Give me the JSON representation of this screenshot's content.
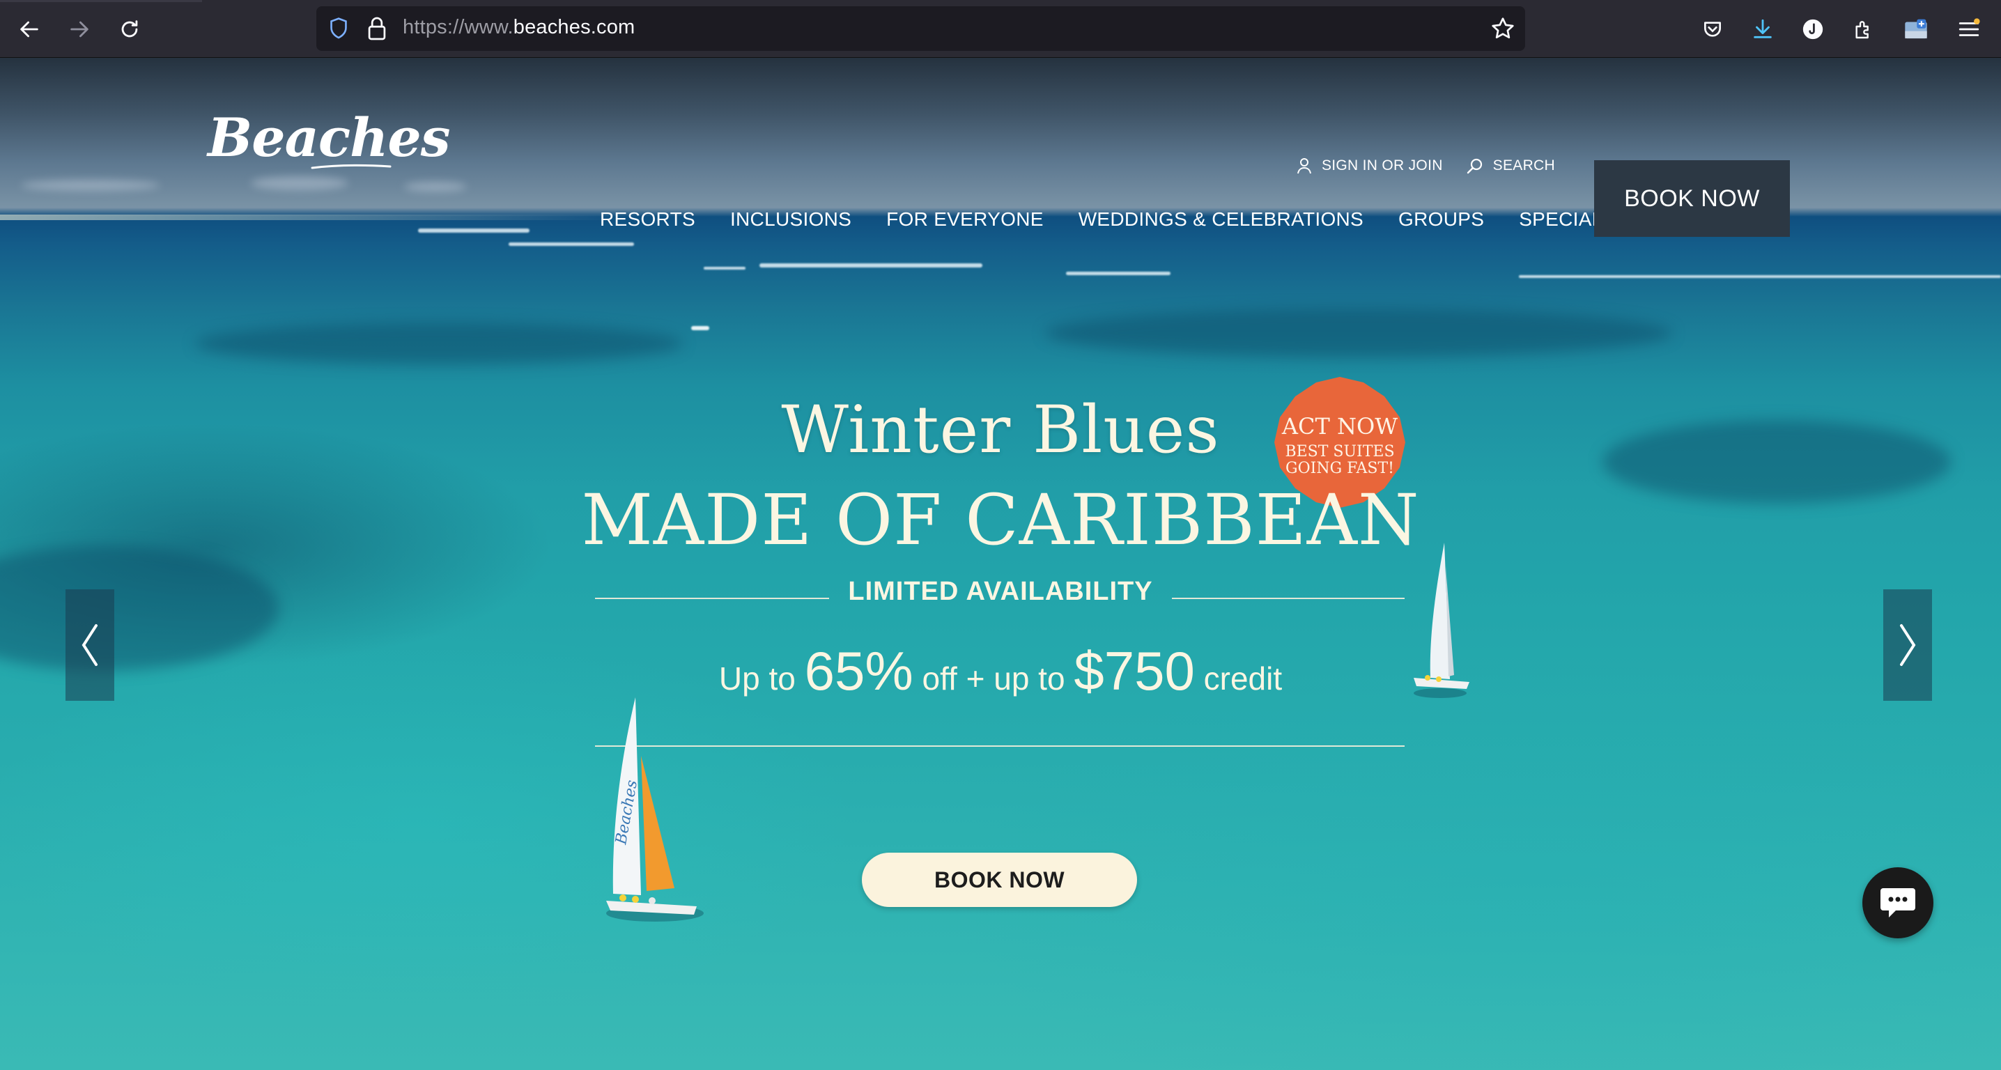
{
  "browser": {
    "url_dim": "https://www.",
    "url_domain": "beaches.com"
  },
  "header": {
    "logo": "Beaches",
    "sign_in": "SIGN IN OR JOIN",
    "search": "SEARCH",
    "book_now": "BOOK NOW",
    "nav": [
      "RESORTS",
      "INCLUSIONS",
      "FOR EVERYONE",
      "WEDDINGS & CELEBRATIONS",
      "GROUPS",
      "SPECIALS"
    ]
  },
  "hero": {
    "title_line1": "Winter Blues",
    "title_line2": "MADE OF CARIBBEAN",
    "limited": "LIMITED AVAILABILITY",
    "offer_prefix": "Up to",
    "offer_pct": "65%",
    "offer_mid": "off + up to",
    "offer_amount": "$750",
    "offer_suffix": "credit",
    "book_now": "BOOK NOW",
    "badge_line1": "ACT NOW",
    "badge_line2": "BEST SUITES",
    "badge_line3": "GOING FAST!",
    "sail_text": "Beaches"
  },
  "colors": {
    "badge": "#e8663a",
    "header_book_bg": "#2c3844",
    "cream": "#fbf6e2"
  }
}
